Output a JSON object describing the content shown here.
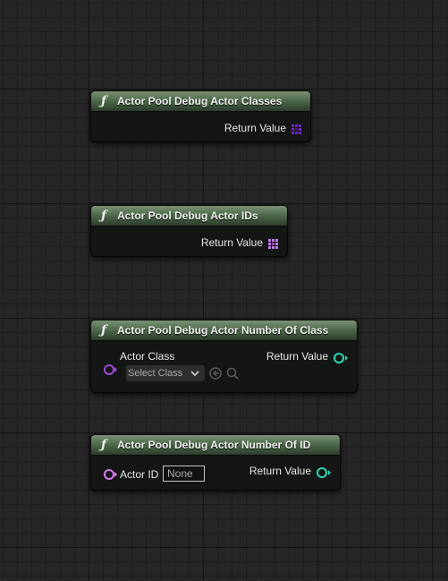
{
  "nodes": [
    {
      "title": "Actor Pool Debug Actor Classes",
      "icon": "function-icon",
      "outputs": [
        {
          "label": "Return Value",
          "type": "array",
          "color": "#7a1fd4"
        }
      ]
    },
    {
      "title": "Actor Pool Debug Actor IDs",
      "icon": "function-icon",
      "outputs": [
        {
          "label": "Return Value",
          "type": "array",
          "color": "#c27cf0"
        }
      ]
    },
    {
      "title": "Actor Pool Debug Actor Number Of Class",
      "icon": "function-icon",
      "inputs": [
        {
          "label": "Actor Class",
          "select_placeholder": "Select Class",
          "color": "#9f4ad8"
        }
      ],
      "outputs": [
        {
          "label": "Return Value",
          "type": "integer",
          "color": "#2dd8b4"
        }
      ]
    },
    {
      "title": "Actor Pool Debug Actor Number Of ID",
      "icon": "function-icon",
      "inputs": [
        {
          "label": "Actor ID",
          "value": "None",
          "color": "#d77cf0"
        }
      ],
      "outputs": [
        {
          "label": "Return Value",
          "type": "integer",
          "color": "#2dd8b4"
        }
      ]
    }
  ],
  "colors": {
    "header_light": "#7c9176",
    "header_dark": "#2d3d2c",
    "body": "#141515",
    "integer_pin": "#2dd8b4"
  }
}
